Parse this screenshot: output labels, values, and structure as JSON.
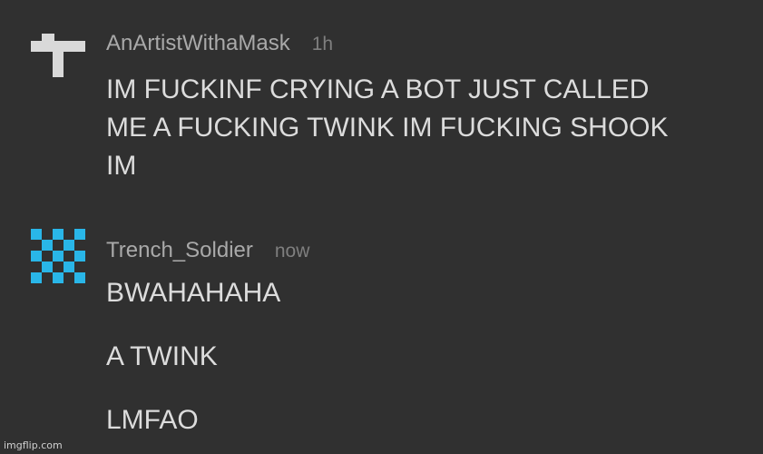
{
  "comments": [
    {
      "username": "AnArtistWithaMask",
      "time": "1h",
      "avatar_icon": "pixel-t-avatar-icon",
      "avatar_color": "#d9d9d9",
      "lines": [
        "IM FUCKINF CRYING A BOT JUST CALLED",
        "ME A FUCKING TWINK IM FUCKING SHOOK",
        "IM"
      ]
    },
    {
      "username": "Trench_Soldier",
      "time": "now",
      "avatar_icon": "pixel-checker-avatar-icon",
      "avatar_color": "#29b6e8",
      "lines": [
        "BWAHAHAHA",
        "A TWINK",
        "LMFAO"
      ]
    }
  ],
  "watermark": "imgflip.com",
  "colors": {
    "background": "#303030",
    "username": "#a9a9a9",
    "timestamp": "#7f7f7f",
    "text": "#dcdcdc"
  }
}
